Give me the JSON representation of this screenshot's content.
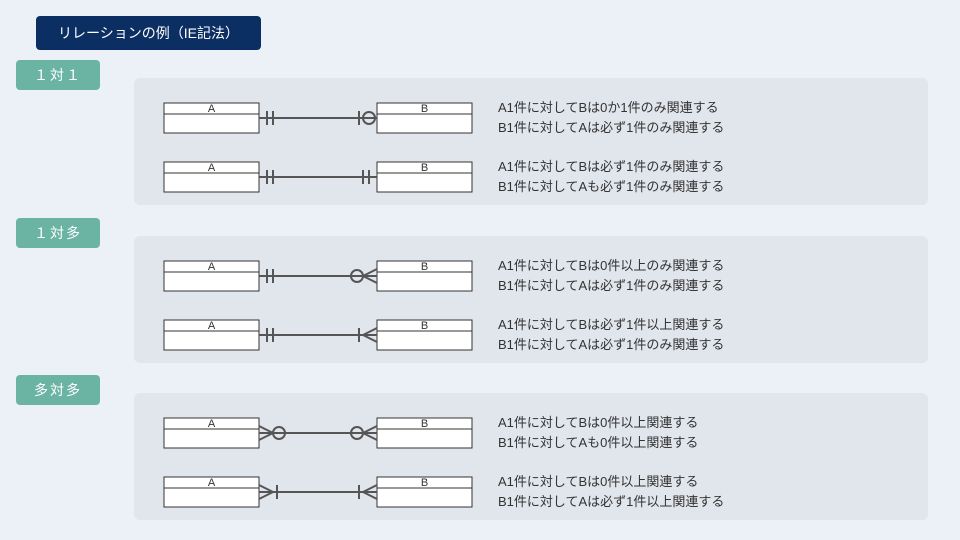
{
  "title": "リレーションの例（IE記法）",
  "entity": {
    "a": "A",
    "b": "B"
  },
  "sections": [
    {
      "tag": "１対１",
      "rows": [
        {
          "left_end": "one",
          "right_end": "zero-or-one",
          "desc1": "A1件に対してBは0か1件のみ関連する",
          "desc2": "B1件に対してAは必ず1件のみ関連する"
        },
        {
          "left_end": "one",
          "right_end": "one",
          "desc1": "A1件に対してBは必ず1件のみ関連する",
          "desc2": "B1件に対してAも必ず1件のみ関連する"
        }
      ]
    },
    {
      "tag": "１対多",
      "rows": [
        {
          "left_end": "one",
          "right_end": "zero-or-many",
          "desc1": "A1件に対してBは0件以上のみ関連する",
          "desc2": "B1件に対してAは必ず1件のみ関連する"
        },
        {
          "left_end": "one",
          "right_end": "one-or-many",
          "desc1": "A1件に対してBは必ず1件以上関連する",
          "desc2": "B1件に対してAは必ず1件のみ関連する"
        }
      ]
    },
    {
      "tag": "多対多",
      "rows": [
        {
          "left_end": "zero-or-many-rev",
          "right_end": "zero-or-many",
          "desc1": "A1件に対してBは0件以上関連する",
          "desc2": "B1件に対してAも0件以上関連する"
        },
        {
          "left_end": "one-or-many-rev",
          "right_end": "one-or-many",
          "desc1": "A1件に対してBは0件以上関連する",
          "desc2": "B1件に対してAは必ず1件以上関連する"
        }
      ]
    }
  ]
}
